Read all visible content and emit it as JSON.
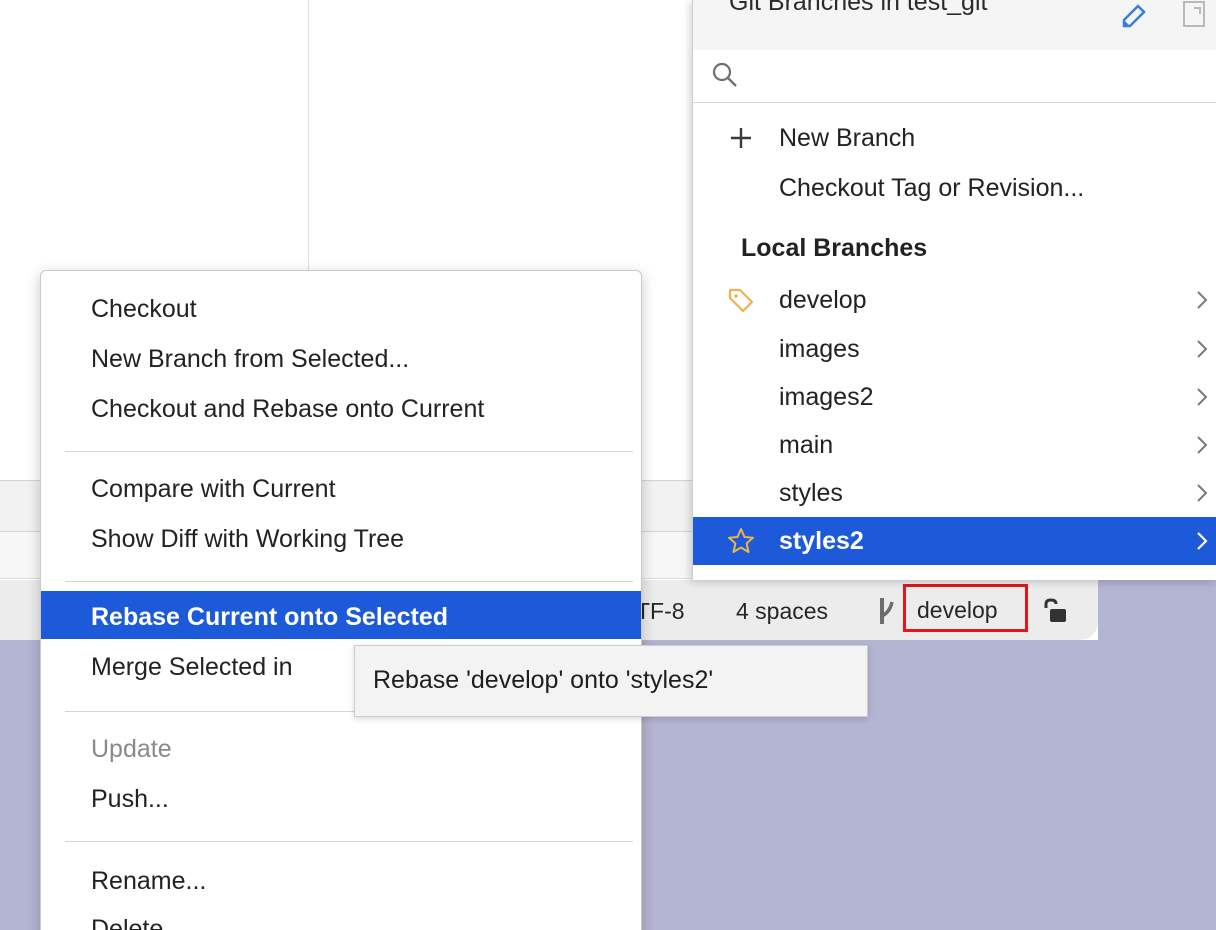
{
  "status_bar": {
    "encoding": "TF-8",
    "indent": "4 spaces",
    "branch": "develop"
  },
  "branches_popup": {
    "title": "Git Branches in test_git",
    "search_placeholder": "",
    "actions": [
      {
        "label": "New Branch",
        "icon": "plus-icon"
      },
      {
        "label": "Checkout Tag or Revision..."
      }
    ],
    "section_heading": "Local Branches",
    "branches": [
      {
        "label": "develop",
        "icon": "tag-icon",
        "current": true
      },
      {
        "label": "images"
      },
      {
        "label": "images2"
      },
      {
        "label": "main"
      },
      {
        "label": "styles"
      },
      {
        "label": "styles2",
        "icon": "star-icon",
        "selected": true
      }
    ],
    "colors": {
      "selection": "#1c5ad9",
      "tag_icon": "#f0b24a",
      "star_icon": "#f0b24a"
    }
  },
  "context_menu": {
    "groups": [
      [
        "Checkout",
        "New Branch from Selected...",
        "Checkout and Rebase onto Current"
      ],
      [
        "Compare with Current",
        "Show Diff with Working Tree"
      ],
      [
        "Rebase Current onto Selected",
        "Merge Selected in"
      ],
      [
        "Update",
        "Push..."
      ],
      [
        "Rename...",
        "Delete"
      ]
    ],
    "items": {
      "checkout": "Checkout",
      "new_branch_from_selected": "New Branch from Selected...",
      "checkout_and_rebase": "Checkout and Rebase onto Current",
      "compare_with_current": "Compare with Current",
      "show_diff": "Show Diff with Working Tree",
      "rebase_current": "Rebase Current onto Selected",
      "merge_selected": "Merge Selected in",
      "update": "Update",
      "push": "Push...",
      "rename": "Rename...",
      "delete": "Delete"
    },
    "selected_item": "Rebase Current onto Selected",
    "disabled_items": [
      "Update"
    ]
  },
  "tooltip": {
    "text": "Rebase 'develop' onto 'styles2'"
  },
  "colors": {
    "desktop": "#b4b4d3",
    "highlight_box": "#e8131b"
  }
}
